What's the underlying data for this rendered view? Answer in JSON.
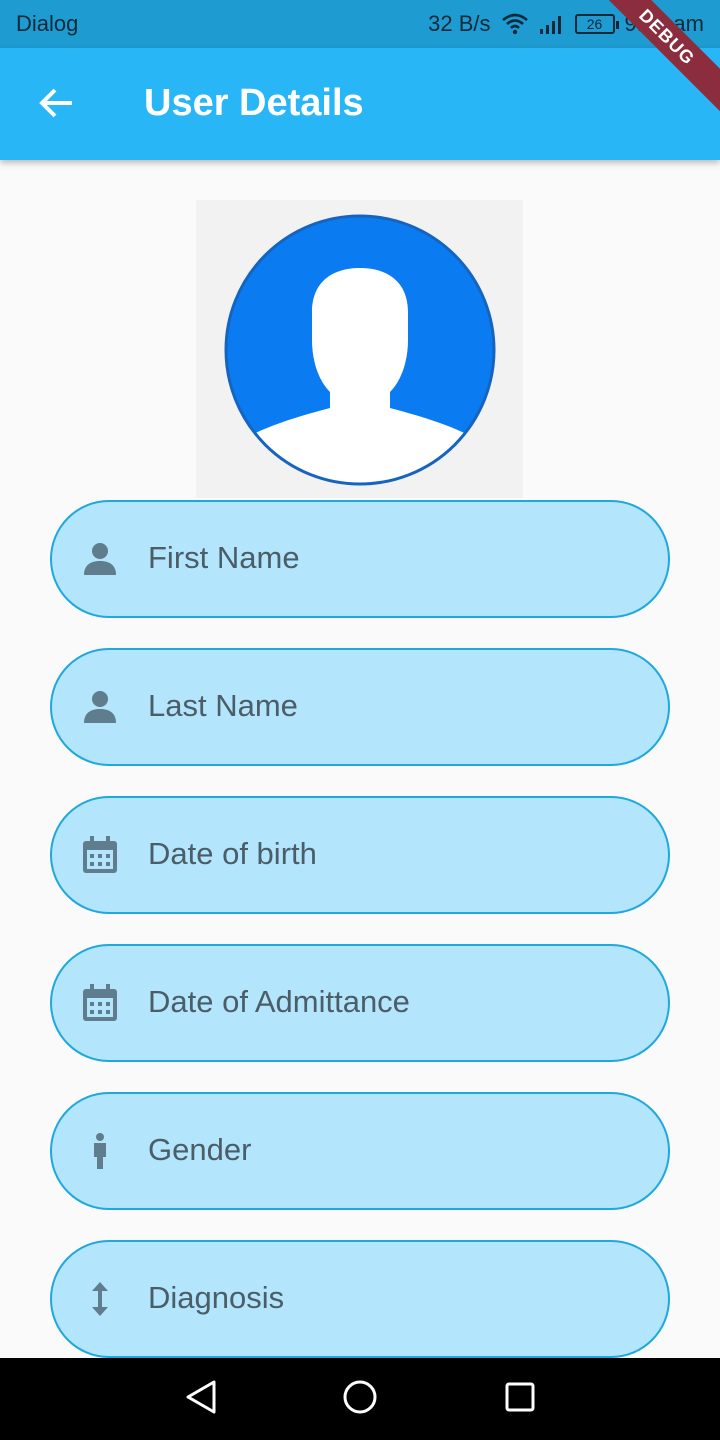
{
  "status_bar": {
    "app_name": "Dialog",
    "network_speed": "32 B/s",
    "battery_level": "26",
    "time": "9:57 am"
  },
  "app_bar": {
    "title": "User Details",
    "back_icon": "arrow-back-icon",
    "debug_label": "DEBUG"
  },
  "form": {
    "fields": [
      {
        "icon": "person-icon",
        "placeholder": "First Name"
      },
      {
        "icon": "person-icon",
        "placeholder": "Last Name"
      },
      {
        "icon": "calendar-icon",
        "placeholder": "Date of birth"
      },
      {
        "icon": "calendar-icon",
        "placeholder": "Date of Admittance"
      },
      {
        "icon": "standing-person-icon",
        "placeholder": "Gender"
      },
      {
        "icon": "vertical-arrows-icon",
        "placeholder": "Diagnosis"
      }
    ]
  },
  "colors": {
    "app_bar": "#29b6f6",
    "status_bar": "#1e9bd0",
    "field_fill": "#b3e5fc",
    "field_border": "#1ea8dc",
    "avatar_blue": "#0a7bf0",
    "icon_color": "#5f7d8c"
  },
  "nav_bar": {
    "back": "nav-back-icon",
    "home": "nav-home-icon",
    "recents": "nav-recents-icon"
  }
}
